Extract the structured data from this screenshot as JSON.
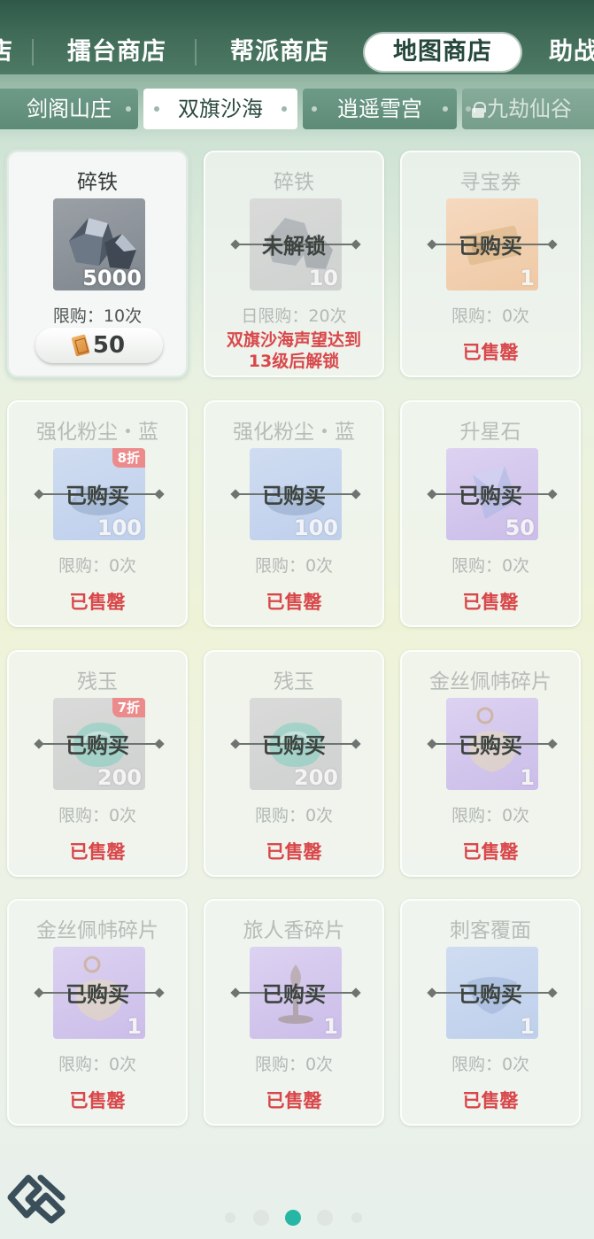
{
  "top_tabs": [
    {
      "label": "店"
    },
    {
      "label": "擂台商店"
    },
    {
      "label": "帮派商店"
    },
    {
      "label": "地图商店",
      "active": true
    },
    {
      "label": "助战"
    }
  ],
  "sub_tabs": [
    {
      "label": "剑阁山庄"
    },
    {
      "label": "双旗沙海",
      "active": true
    },
    {
      "label": "逍遥雪宫"
    },
    {
      "label": "九劫仙谷",
      "locked": true
    }
  ],
  "items": [
    {
      "name": "碎铁",
      "qty": "5000",
      "limit": "限购：10次",
      "price": "50",
      "state": "available",
      "color": "grey"
    },
    {
      "name": "碎铁",
      "qty": "10",
      "limit": "日限购：20次",
      "overlay": "未解锁",
      "note_line1": "双旗沙海声望达到",
      "note_line2": "13级后解锁",
      "state": "locked",
      "color": "grey"
    },
    {
      "name": "寻宝券",
      "qty": "1",
      "limit": "限购：0次",
      "overlay": "已购买",
      "status": "已售罄",
      "state": "soldout",
      "color": "gold"
    },
    {
      "name": "强化粉尘・蓝",
      "qty": "100",
      "discount": "8折",
      "limit": "限购：0次",
      "overlay": "已购买",
      "status": "已售罄",
      "state": "soldout",
      "color": "blue"
    },
    {
      "name": "强化粉尘・蓝",
      "qty": "100",
      "limit": "限购：0次",
      "overlay": "已购买",
      "status": "已售罄",
      "state": "soldout",
      "color": "blue"
    },
    {
      "name": "升星石",
      "qty": "50",
      "limit": "限购：0次",
      "overlay": "已购买",
      "status": "已售罄",
      "state": "soldout",
      "color": "purple"
    },
    {
      "name": "残玉",
      "qty": "200",
      "discount": "7折",
      "limit": "限购：0次",
      "overlay": "已购买",
      "status": "已售罄",
      "state": "soldout",
      "color": "grey"
    },
    {
      "name": "残玉",
      "qty": "200",
      "limit": "限购：0次",
      "overlay": "已购买",
      "status": "已售罄",
      "state": "soldout",
      "color": "grey"
    },
    {
      "name": "金丝佩帏碎片",
      "qty": "1",
      "limit": "限购：0次",
      "overlay": "已购买",
      "status": "已售罄",
      "state": "soldout",
      "color": "purple"
    },
    {
      "name": "金丝佩帏碎片",
      "qty": "1",
      "limit": "限购：0次",
      "overlay": "已购买",
      "status": "已售罄",
      "state": "soldout",
      "color": "purple"
    },
    {
      "name": "旅人香碎片",
      "qty": "1",
      "limit": "限购：0次",
      "overlay": "已购买",
      "status": "已售罄",
      "state": "soldout",
      "color": "purple"
    },
    {
      "name": "刺客覆面",
      "qty": "1",
      "limit": "限购：0次",
      "overlay": "已购买",
      "status": "已售罄",
      "state": "soldout",
      "color": "blue"
    }
  ],
  "pager": {
    "count": 5,
    "active_index": 2
  },
  "icons": {
    "logo": "game-logo-icon",
    "currency": "ticket-icon",
    "lock": "lock-icon"
  }
}
